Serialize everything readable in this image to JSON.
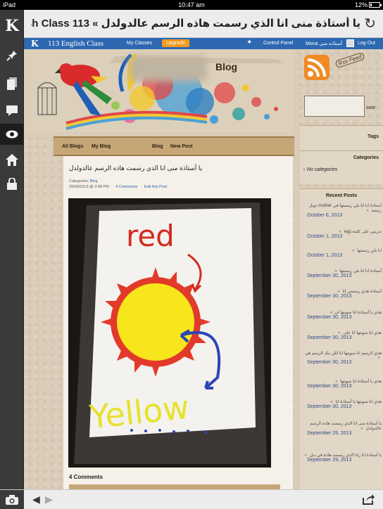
{
  "status_bar": {
    "device": "iPad",
    "time": "10:47 am",
    "battery": "12%"
  },
  "title_bar": {
    "title": "يا أستاذة منى انا الذي رسمت هاذه الرسم عالدولدل » 113 English Class"
  },
  "top_bar": {
    "logo": "K",
    "site_name": "113 English Class",
    "my_classes": "My Classes",
    "upgrade": "Upgrade",
    "control_panel": "Control Panel",
    "user": "Mona أستاذه منى",
    "log_out": "Log Out"
  },
  "header": {
    "blog_title": "Blog"
  },
  "nav": {
    "all_blogs": "All Blogs",
    "my_blog": "My Blog",
    "blog": "Blog",
    "new_post": "New Post"
  },
  "post": {
    "title": "يا أستاذة منى انا الذي رسمت هاذه الرسم عالدولدل",
    "categories_label": "Categories:",
    "category": "Blog",
    "datetime": "29/09/2013 @ 3:58 PM",
    "comments_link": "4 Comments",
    "edit_link": "Edit this Post",
    "comments_heading": "4 Comments"
  },
  "drawing_text": {
    "red": "red",
    "yellow": "Yellow"
  },
  "sidebar": {
    "rss_label": "Rss Feed",
    "search_label": "sear",
    "tags_heading": "Tags",
    "categories_heading": "Categories",
    "no_categories": "No categories",
    "recent_posts_heading": "Recent Posts",
    "recent_posts": [
      {
        "title": "أستاذة انا انا بلي رسمتها في mother دوبل رسمة",
        "date": "October 6, 2013"
      },
      {
        "title": "تدريبي على كلمة egg",
        "date": "October 1, 2013"
      },
      {
        "title": "انا بلي رسمتها",
        "date": "October 1, 2013"
      },
      {
        "title": "أستاذة انا انا بلي رسمتها",
        "date": "September 30, 2013"
      },
      {
        "title": "أستاذة هذي رسمتي انا",
        "date": "September 30, 2013"
      },
      {
        "title": "هذي يا أستاذة انا سويتها ان",
        "date": "September 30, 2013"
      },
      {
        "title": "هذي انا سويتها انا على",
        "date": "September 30, 2013"
      },
      {
        "title": "هذي الرسم انا سويتها انا لكن نبك الرسم هي",
        "date": "September 30, 2013"
      },
      {
        "title": "هذي يا أستاذة انا سويتها",
        "date": "September 30, 2013"
      },
      {
        "title": "هذي انا سويتها يا أستاذة انا",
        "date": "September 30, 2013"
      },
      {
        "title": "يا أستاذة منى انا الذي رسمت هاذه الرسم عالدولدل",
        "date": "September 29, 2013"
      },
      {
        "title": "يا أستاذة انا رانا الذي رسمت هاذه في دبل",
        "date": "September 29, 2013"
      }
    ]
  },
  "icons": {
    "reload": "reload-icon",
    "pin": "pin-icon",
    "pages": "pages-icon",
    "comment": "comment-icon",
    "eye": "eye-icon",
    "home": "home-icon",
    "lock": "lock-icon",
    "camera": "camera-icon",
    "share": "share-icon"
  },
  "colors": {
    "bluebar": "#2d68b1",
    "upgrade": "#f59a1c",
    "rss": "#f08a24",
    "sidebar": "#3a3a3a"
  }
}
